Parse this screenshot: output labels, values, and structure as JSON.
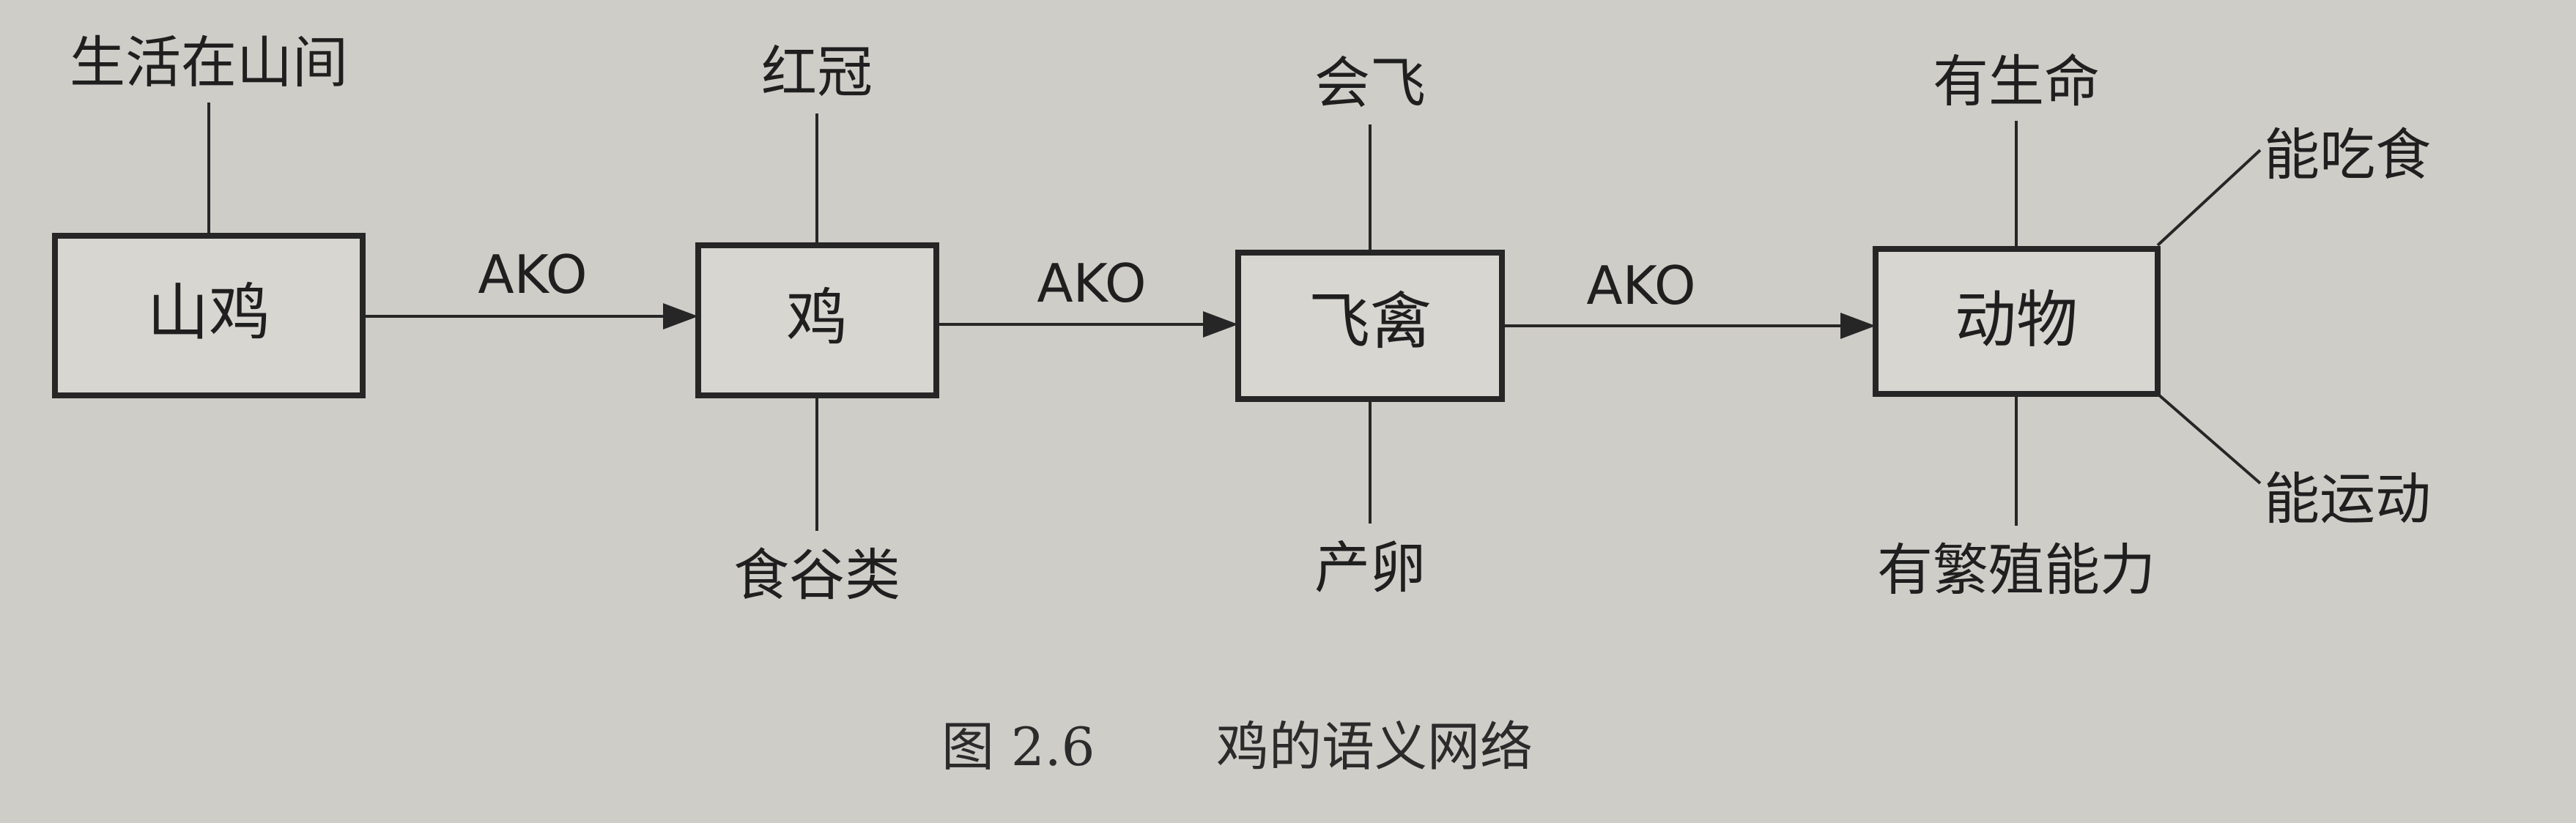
{
  "nodes": [
    {
      "id": "shanji",
      "label": "山鸡"
    },
    {
      "id": "ji",
      "label": "鸡"
    },
    {
      "id": "feiqin",
      "label": "飞禽"
    },
    {
      "id": "dongwu",
      "label": "动物"
    }
  ],
  "edges": [
    {
      "from": "shanji",
      "to": "ji",
      "label": "AKO"
    },
    {
      "from": "ji",
      "to": "feiqin",
      "label": "AKO"
    },
    {
      "from": "feiqin",
      "to": "dongwu",
      "label": "AKO"
    }
  ],
  "attributes": {
    "shanji": [
      "生活在山间"
    ],
    "ji": [
      "红冠",
      "食谷类"
    ],
    "feiqin": [
      "会飞",
      "产卵"
    ],
    "dongwu": [
      "有生命",
      "有繁殖能力",
      "能吃食",
      "能运动"
    ]
  },
  "caption": {
    "number": "图 2.6",
    "text": "鸡的语义网络"
  }
}
